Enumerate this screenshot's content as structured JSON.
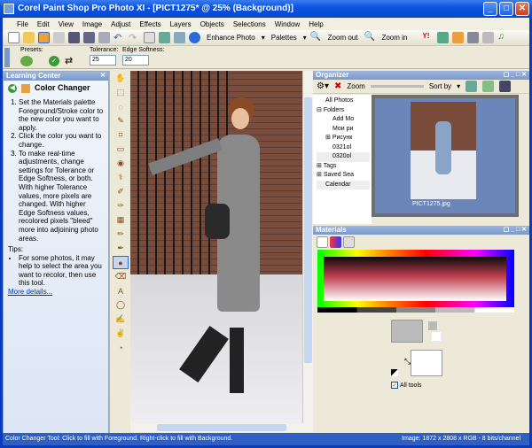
{
  "window": {
    "title": "Corel Paint Shop Pro Photo XI - [PICT1275* @  25% (Background)]",
    "minimize": "_",
    "maximize": "□",
    "close": "✕"
  },
  "menu": [
    "File",
    "Edit",
    "View",
    "Image",
    "Adjust",
    "Effects",
    "Layers",
    "Objects",
    "Selections",
    "Window",
    "Help"
  ],
  "toolbar": {
    "enhance_photo": "Enhance Photo",
    "palettes": "Palettes",
    "zoom_out": "Zoom out",
    "zoom_in": "Zoom in"
  },
  "options": {
    "presets_label": "Presets:",
    "tolerance_label": "Tolerance:",
    "tolerance_value": "25",
    "edge_label": "Edge Softness:",
    "edge_value": "20"
  },
  "learning_center": {
    "title": "Learning Center",
    "heading": "Color Changer",
    "steps": [
      "Set the Materials palette Foreground/Stroke color to the new color you want to apply.",
      "Click the color you want to change.",
      "To make real-time adjustments, change settings for Tolerance or Edge Softness, or both. With higher Tolerance values, more pixels are changed. With higher Edge Softness values, recolored pixels \"bleed\" more into adjoining photo areas."
    ],
    "tips_label": "Tips:",
    "tips": [
      "For some photos, it may help to select the area you want to recolor, then use this tool."
    ],
    "more_details": "More details..."
  },
  "organizer": {
    "title": "Organizer",
    "zoom_label": "Zoom",
    "sort_by": "Sort by",
    "tree": [
      "All Photos",
      "Folders",
      "Add Mo",
      "Мои ри",
      "Рисунк",
      "0321ol",
      "0320ol",
      "Tags",
      "Saved Sea",
      "Calendar"
    ],
    "thumbnail_name": "PICT1275.jpg"
  },
  "materials": {
    "title": "Materials",
    "all_tools": "All tools",
    "all_tools_checked": true
  },
  "status": {
    "left": "Color Changer Tool: Click to fill with Foreground. Right-click to fill with Background.",
    "right": "Image:  1872 x 2808 x RGB - 8 bits/channel"
  },
  "colors": {
    "title_bar": "#0a55e0",
    "panel_header": "#7a97c8",
    "thumb_bg": "#6b86b8"
  }
}
